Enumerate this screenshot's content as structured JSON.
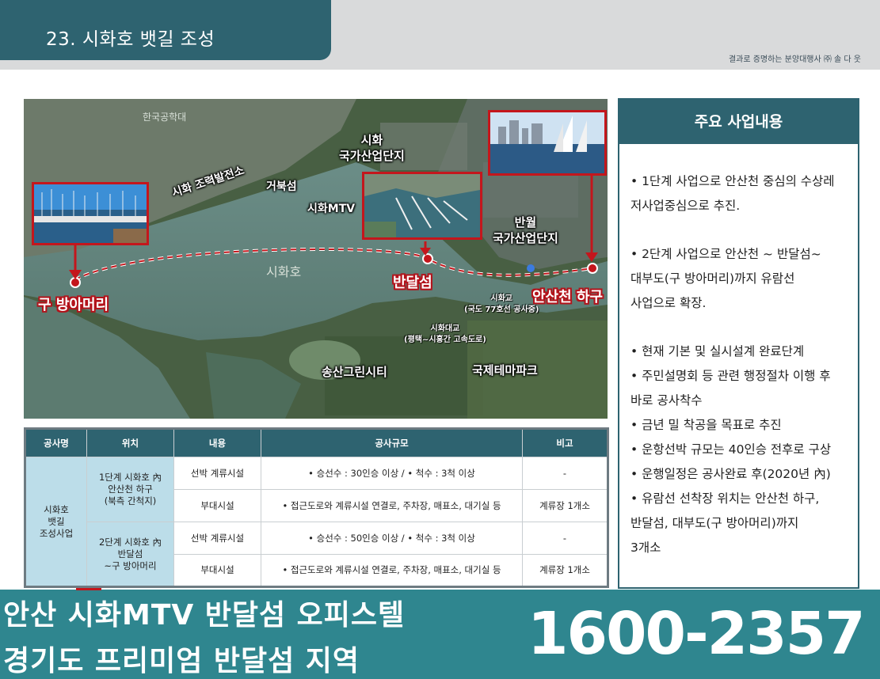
{
  "header": {
    "title": "23. 시화호 뱃길 조성",
    "tagline": "결과로 증명하는 분양대행사 ㈜ 솔 다 웃"
  },
  "map": {
    "labels": {
      "sihwa_power_plant": "시화 조력발전소",
      "geobukseom": "거북섬",
      "sihwa_mtv": "시화MTV",
      "sihwa_industrial": "시화\n국가산업단지",
      "banwol_industrial": "반월\n국가산업단지",
      "sihwaho": "시화호",
      "gu_bangameori": "구 방아머리",
      "bandalseom": "반달섬",
      "ansancheon": "안산천 하구",
      "sihwagyo": "시화교\n(국도 77호선 공사중)",
      "sihwadaegyo": "시화대교\n(평택~시흥간 고속도로)",
      "songsan_green_city": "송산그린시티",
      "theme_park": "국제테마파크",
      "top_faint": "한국공학대"
    }
  },
  "panel": {
    "heading": "주요 사업내용",
    "items": [
      "• 1단계 사업으로 안산천 중심의 수상레\n저사업중심으로 추진.",
      "• 2단계 사업으로 안산천 ~ 반달섬~\n  대부도(구 방아머리)까지 유람선\n  사업으로 확장.",
      "• 현재 기본 및 실시설계 완료단계",
      "• 주민설명회 등 관련 행정절차 이행 후\n  바로 공사착수",
      "• 금년 밀 착공을 목표로 추진",
      "• 운항선박 규모는 40인승 전후로 구상",
      "• 운행일정은 공사완료 후(2020년 內)",
      "• 유람선 선착장 위치는 안산천 하구,\n  반달섬, 대부도(구 방아머리)까지\n  3개소"
    ]
  },
  "table": {
    "headers": [
      "공사명",
      "위치",
      "내용",
      "공사규모",
      "비고"
    ],
    "project": "시화호\n뱃길\n조성사업",
    "rows": [
      {
        "location": "1단계 시화호 內\n안산천 하구\n(북측 간척지)",
        "content": "선박 계류시설",
        "scale": "• 승선수 : 30인승 이상 / • 척수 : 3척 이상",
        "note": "-"
      },
      {
        "content": "부대시설",
        "scale": "•  접근도로와 계류시설 연결로, 주차장, 매표소, 대기실 등",
        "note": "계류장 1개소"
      },
      {
        "location": "2단계 시화호 內\n반달섬\n~구 방아머리",
        "content": "선박 계류시설",
        "scale": "• 승선수 : 50인승 이상 / • 척수 : 3척 이상",
        "note": "-"
      },
      {
        "content": "부대시설",
        "scale": "•  접근도로와 계류시설 연결로, 주차장, 매표소, 대기실 등",
        "note": "계류장 1개소"
      }
    ]
  },
  "banner": {
    "line1": "안산 시화MTV 반달섬 오피스텔",
    "line2": "경기도 프리미엄 반달섬 지역",
    "phone": "1600-2357"
  },
  "colors": {
    "teal": "#2e6370",
    "banner_teal": "#2f868f",
    "accent_red": "#c4161c",
    "table_shade": "#bcdde9"
  }
}
